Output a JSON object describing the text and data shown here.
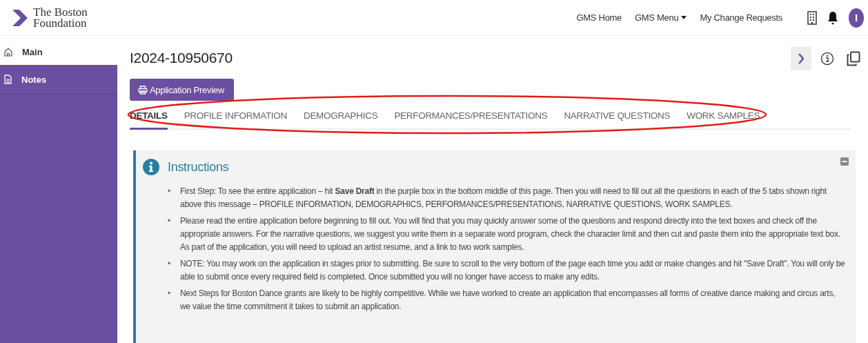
{
  "header": {
    "logo_lines": [
      "The Boston",
      "Foundation"
    ],
    "nav": [
      {
        "label": "GMS Home",
        "kind": "link"
      },
      {
        "label": "GMS Menu",
        "kind": "dropdown"
      },
      {
        "label": "My Change Requests",
        "kind": "link"
      }
    ],
    "avatar": "I"
  },
  "sidebar": {
    "items": [
      {
        "label": "Main",
        "selected": true
      },
      {
        "label": "Notes",
        "selected": false
      }
    ]
  },
  "page": {
    "title": "I2024-10950670",
    "preview_button": "Application Preview",
    "tabs": [
      {
        "label": "DETAILS",
        "selected": true
      },
      {
        "label": "PROFILE INFORMATION",
        "selected": false
      },
      {
        "label": "DEMOGRAPHICS",
        "selected": false
      },
      {
        "label": "PERFORMANCES/PRESENTATIONS",
        "selected": false
      },
      {
        "label": "NARRATIVE QUESTIONS",
        "selected": false
      },
      {
        "label": "WORK SAMPLES",
        "selected": false
      }
    ]
  },
  "instructions": {
    "title": "Instructions",
    "bullet": "•",
    "items": [
      "First Step: To see the entire application – hit **Save Draft** in the purple box in the bottom middle of this page. Then you will need to fill out all the questions in each of the 5 tabs shown right above this message – PROFILE INFORMATION, DEMOGRAPHICS, PERFORMANCES/PRESENTATIONS, NARRATIVE QUESTIONS, WORK SAMPLES.",
      "Please read the entire application before beginning to fill out. You will find that you may quickly answer some of the questions and respond directly into the text boxes and check off the appropriate answers. For the narrative questions, we suggest you write them in a separate word program, check the character limit and then cut and paste them into the appropriate text box. As part of the application, you will need to upload an artist resume, and a link to two work samples.",
      "NOTE: You may work on the application in stages prior to submitting. Be sure to scroll to the very bottom of the page each time you add or make changes and hit \"Save Draft\". You will only be able to submit once every required field is completed. Once submitted you will no longer have access to make any edits.",
      "Next Steps for Boston Dance grants are likely to be highly competitive. While we have worked to create an application that encompasses all forms of creative dance making and circus arts, we value the time commitment it takes to submit an application."
    ]
  }
}
